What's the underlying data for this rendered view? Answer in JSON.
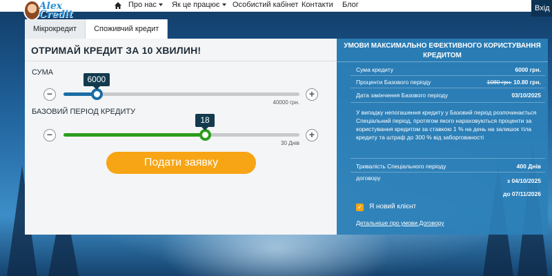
{
  "nav": {
    "logo_text": "Alex Credit",
    "items": [
      "Про нас",
      "Як це працює",
      "Особистий кабінет",
      "Контакти",
      "Блог"
    ],
    "login_label": "Вхід",
    "home_icon": "home-icon"
  },
  "tabs": [
    {
      "label": "Мікрокредит",
      "active": false
    },
    {
      "label": "Споживчий кредит",
      "active": true
    }
  ],
  "calculator": {
    "title": "ОТРИМАЙ КРЕДИТ ЗА 10 ХВИЛИН!",
    "amount": {
      "label": "СУМА",
      "value": "6000",
      "max_label": "40000 грн.",
      "value_num": 6000,
      "min": 500,
      "max": 40000
    },
    "period": {
      "label": "БАЗОВИЙ ПЕРІОД КРЕДИТУ",
      "value": "18",
      "max_label": "30 Днів",
      "value_num": 18,
      "min": 0,
      "max": 30
    },
    "minus_symbol": "−",
    "plus_symbol": "+",
    "submit_label": "Подати заявку"
  },
  "terms": {
    "title": "УМОВИ МАКСИМАЛЬНО ЕФЕКТИВНОГО КОРИСТУВАННЯ КРЕДИТОМ",
    "rows": [
      {
        "label": "Сума кредиту",
        "value": "6000 грн."
      },
      {
        "label": "Проценти Базового періоду",
        "old_value": "1080 грн.",
        "value": "10.80 грн."
      },
      {
        "label": "Дата закінчення Базового періоду",
        "value": "03/10/2025"
      }
    ],
    "paragraph": "У випадку непогашення кредиту у Базовий період розпочинається Спеціальний період, протягом якого нараховуються проценти за користування кредитом за ставкою 1 % на день на залишок тіла кредиту та штраф до 300 % від заборгованості",
    "special_label": "Тривалість Спеціального періоду",
    "special_value": "400 Днів",
    "contract_label": "договору",
    "contract_from": "з 04/10/2025",
    "contract_to": "до 07/11/2026",
    "new_client_label": "Я новий клієнт",
    "new_client_checked": true,
    "more_link": "Детальніше про умови Договору"
  },
  "colors": {
    "accent_orange": "#f7a514",
    "amount_slider": "#1b6da3",
    "period_slider": "#2a9d1d",
    "terms_bg": "#2c80b8",
    "tooltip_bg": "#133a4d"
  }
}
